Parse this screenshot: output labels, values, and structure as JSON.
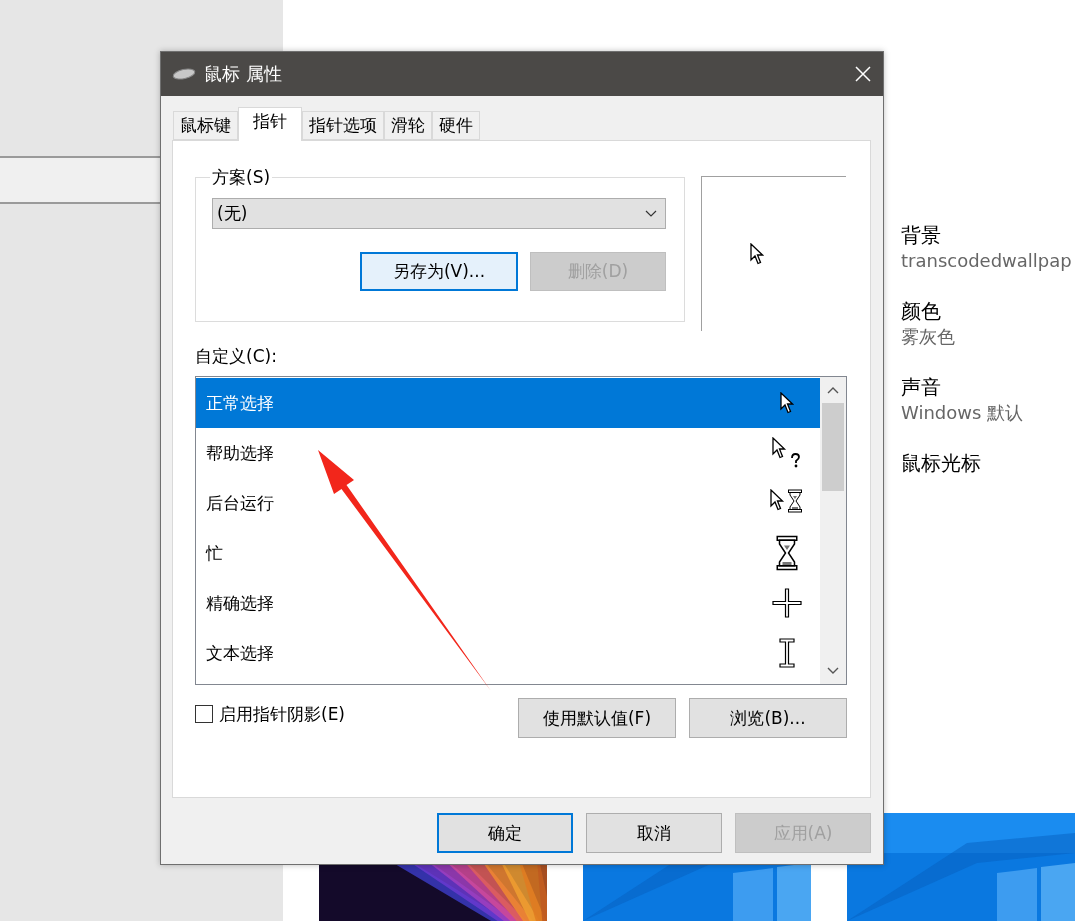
{
  "window": {
    "title": "鼠标 属性"
  },
  "tabs": [
    {
      "label": "鼠标键",
      "selected": false
    },
    {
      "label": "指针",
      "selected": true
    },
    {
      "label": "指针选项",
      "selected": false
    },
    {
      "label": "滑轮",
      "selected": false
    },
    {
      "label": "硬件",
      "selected": false
    }
  ],
  "scheme": {
    "label": "方案(S)",
    "value": "(无)",
    "buttons": [
      {
        "label": "另存为(V)...",
        "disabled": false,
        "focused": true
      },
      {
        "label": "删除(D)",
        "disabled": true,
        "focused": false
      }
    ]
  },
  "customize": {
    "label": "自定义(C):",
    "rows": [
      {
        "name": "正常选择",
        "selected": true
      },
      {
        "name": "帮助选择",
        "selected": false
      },
      {
        "name": "后台运行",
        "selected": false
      },
      {
        "name": "忙",
        "selected": false
      },
      {
        "name": "精确选择",
        "selected": false
      },
      {
        "name": "文本选择",
        "selected": false
      }
    ]
  },
  "shadow": {
    "label": "启用指针阴影(E)",
    "checked": false
  },
  "list_buttons": [
    {
      "label": "使用默认值(F)"
    },
    {
      "label": "浏览(B)..."
    }
  ],
  "dialog_buttons": [
    {
      "label": "确定",
      "focused": true,
      "disabled": false
    },
    {
      "label": "取消",
      "focused": false,
      "disabled": false
    },
    {
      "label": "应用(A)",
      "focused": false,
      "disabled": true
    }
  ],
  "settings": [
    {
      "title": "背景",
      "value": "transcodedwallpap"
    },
    {
      "title": "颜色",
      "value": "雾灰色"
    },
    {
      "title": "声音",
      "value": "Windows 默认"
    },
    {
      "title": "鼠标光标"
    }
  ]
}
